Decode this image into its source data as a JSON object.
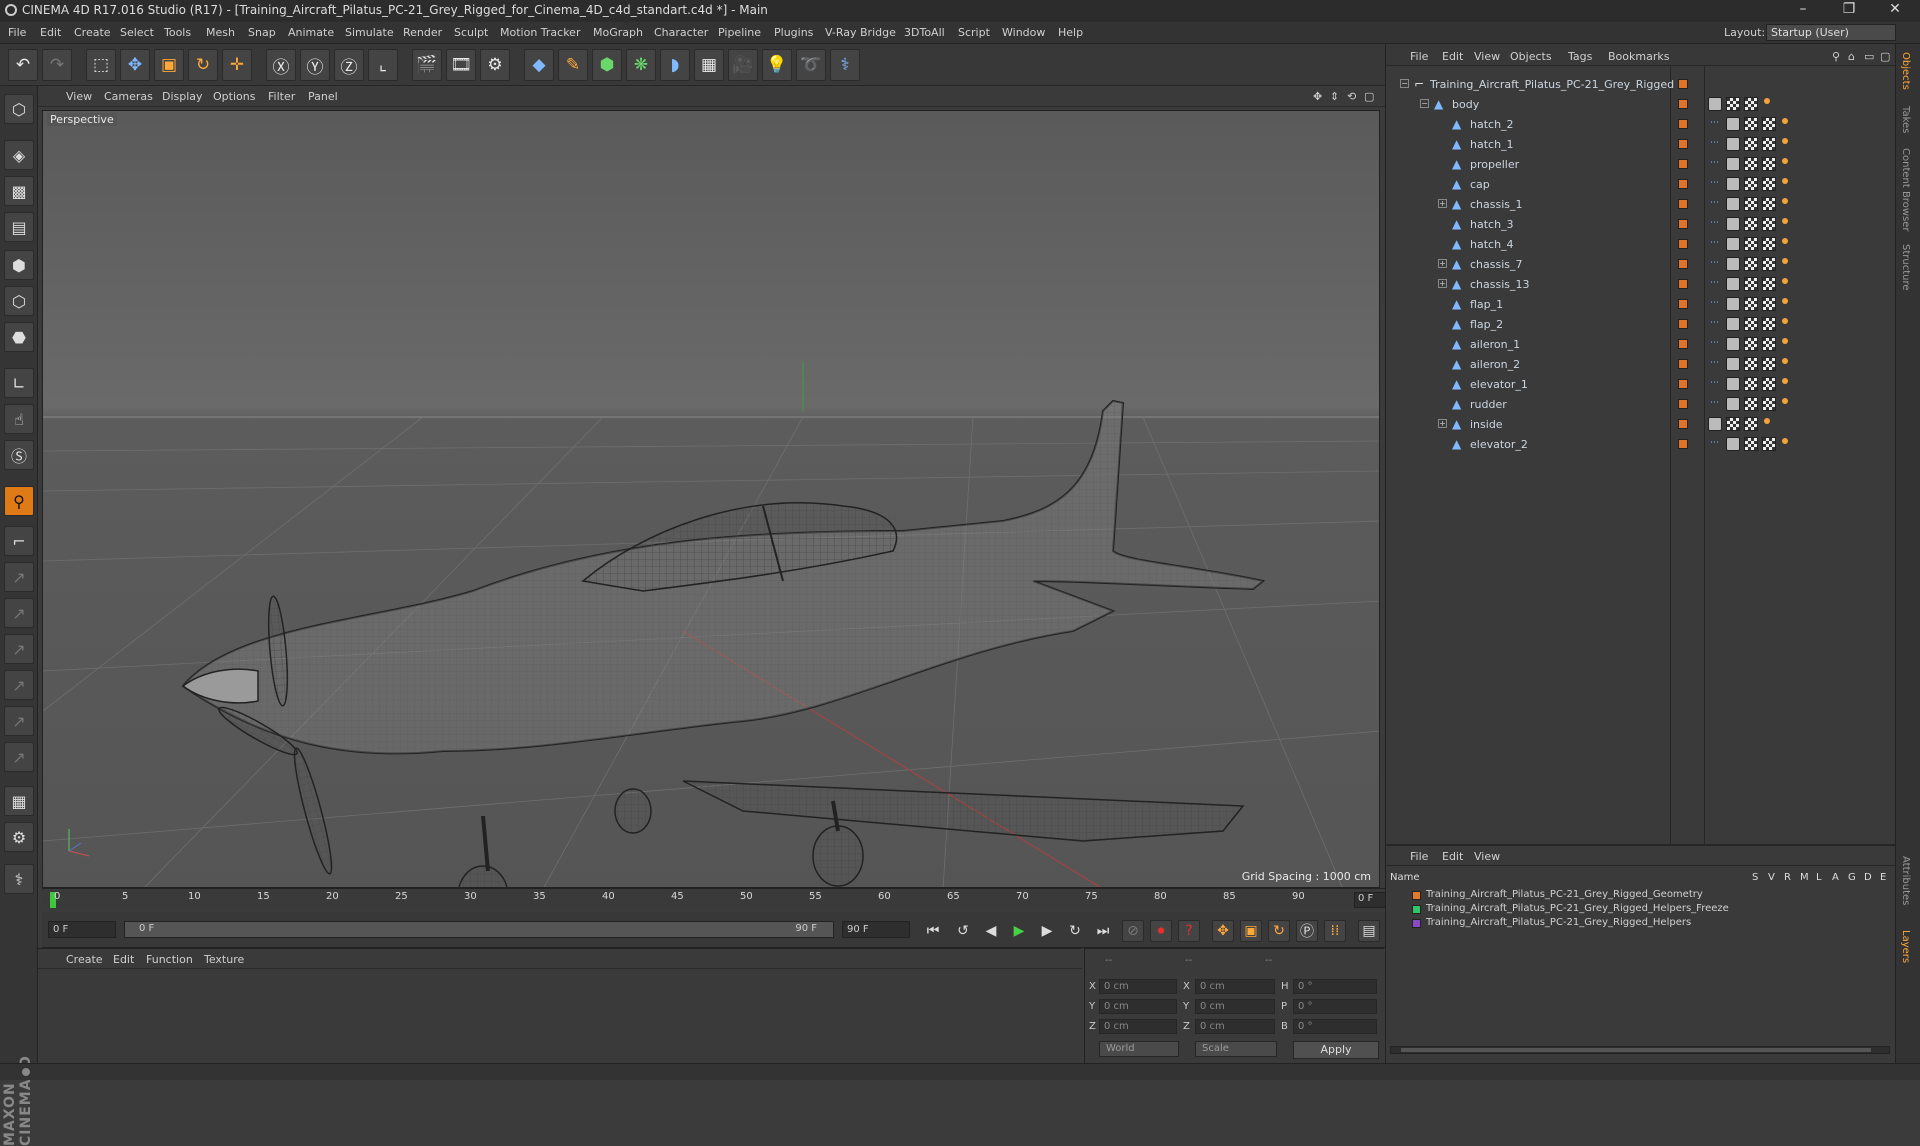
{
  "window": {
    "title": "CINEMA 4D R17.016 Studio (R17) - [Training_Aircraft_Pilatus_PC-21_Grey_Rigged_for_Cinema_4D_c4d_standart.c4d *] - Main"
  },
  "menu": [
    "File",
    "Edit",
    "Create",
    "Select",
    "Tools",
    "Mesh",
    "Snap",
    "Animate",
    "Simulate",
    "Render",
    "Sculpt",
    "Motion Tracker",
    "MoGraph",
    "Character",
    "Pipeline",
    "Plugins",
    "V-Ray Bridge",
    "3DToAll",
    "Script",
    "Window",
    "Help"
  ],
  "layout": {
    "label": "Layout:",
    "value": "Startup (User)"
  },
  "viewport": {
    "menu": [
      "View",
      "Cameras",
      "Display",
      "Options",
      "Filter",
      "Panel"
    ],
    "label": "Perspective",
    "grid_spacing": "Grid Spacing : 1000 cm"
  },
  "timeline": {
    "ticks": [
      "0",
      "5",
      "10",
      "15",
      "20",
      "25",
      "30",
      "35",
      "40",
      "45",
      "50",
      "55",
      "60",
      "65",
      "70",
      "75",
      "80",
      "85",
      "90"
    ],
    "current_frame": "0 F"
  },
  "playback": {
    "start": "0 F",
    "range_start": "0 F",
    "range_end": "90 F",
    "end": "90 F"
  },
  "materials": {
    "menu": [
      "Create",
      "Edit",
      "Function",
      "Texture"
    ]
  },
  "coords": {
    "rows": [
      {
        "a": "X",
        "av": "0 cm",
        "b": "X",
        "bv": "0 cm",
        "c": "H",
        "cv": "0 °"
      },
      {
        "a": "Y",
        "av": "0 cm",
        "b": "Y",
        "bv": "0 cm",
        "c": "P",
        "cv": "0 °"
      },
      {
        "a": "Z",
        "av": "0 cm",
        "b": "Z",
        "bv": "0 cm",
        "c": "B",
        "cv": "0 °"
      }
    ],
    "world": "World",
    "scale": "Scale",
    "apply": "Apply",
    "dashes": [
      "--",
      "--",
      "--"
    ]
  },
  "objects": {
    "menu": [
      "File",
      "Edit",
      "View",
      "Objects",
      "Tags",
      "Bookmarks"
    ],
    "root": "Training_Aircraft_Pilatus_PC-21_Grey_Rigged",
    "body": "body",
    "children": [
      "hatch_2",
      "hatch_1",
      "propeller",
      "cap",
      "chassis_1",
      "hatch_3",
      "hatch_4",
      "chassis_7",
      "chassis_13",
      "flap_1",
      "flap_2",
      "aileron_1",
      "aileron_2",
      "elevator_1",
      "rudder",
      "inside",
      "elevator_2"
    ],
    "expandable": [
      "chassis_1",
      "chassis_7",
      "chassis_13",
      "inside"
    ]
  },
  "layers": {
    "menu": [
      "File",
      "Edit",
      "View"
    ],
    "header": {
      "name": "Name",
      "cols": [
        "S",
        "V",
        "R",
        "M",
        "L",
        "A",
        "G",
        "D",
        "E"
      ]
    },
    "rows": [
      {
        "name": "Training_Aircraft_Pilatus_PC-21_Grey_Rigged_Geometry",
        "color": "#e07a2a"
      },
      {
        "name": "Training_Aircraft_Pilatus_PC-21_Grey_Rigged_Helpers_Freeze",
        "color": "#2ec86a"
      },
      {
        "name": "Training_Aircraft_Pilatus_PC-21_Grey_Rigged_Helpers",
        "color": "#8a4ac8"
      }
    ]
  },
  "side_tabs": [
    "Objects",
    "Takes",
    "Content Browser",
    "Structure",
    "Attributes",
    "Layers"
  ]
}
